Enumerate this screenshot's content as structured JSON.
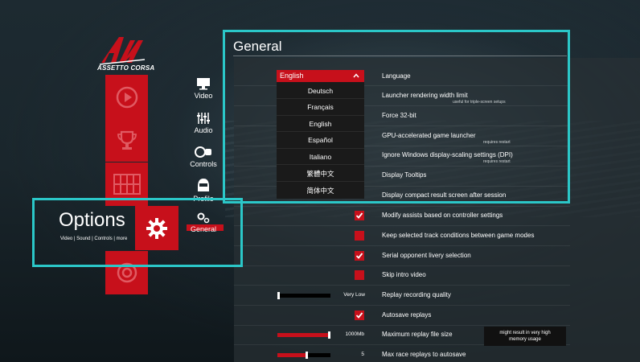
{
  "logo": {
    "text": "ASSETTO CORSA"
  },
  "main_nav": {
    "title": "Options",
    "subtitle": "Video | Sound | Controls | more"
  },
  "sub_nav": [
    {
      "label": "Video",
      "icon": "monitor-icon"
    },
    {
      "label": "Audio",
      "icon": "equalizer-icon"
    },
    {
      "label": "Controls",
      "icon": "controls-icon"
    },
    {
      "label": "Profile",
      "icon": "helmet-icon"
    },
    {
      "label": "General",
      "icon": "gears-icon"
    }
  ],
  "panel": {
    "title": "General"
  },
  "dropdown": {
    "selected": "English",
    "options": [
      "Deutsch",
      "Français",
      "English",
      "Español",
      "Italiano",
      "繁體中文",
      "简体中文"
    ]
  },
  "settings": [
    {
      "label": "Language"
    },
    {
      "label": "Launcher rendering width limit",
      "note": "useful for triple-screen setups"
    },
    {
      "label": "Force 32-bit"
    },
    {
      "label": "GPU-accelerated game launcher",
      "note": "requires restart"
    },
    {
      "label": "Ignore Windows display-scaling settings (DPI)",
      "note": "requires restart"
    },
    {
      "label": "Display Tooltips"
    },
    {
      "label": "Display compact result screen after session"
    },
    {
      "label": "Modify assists based on controller settings",
      "checked": true
    },
    {
      "label": "Keep selected track conditions between game modes",
      "checked": false
    },
    {
      "label": "Serial opponent livery selection",
      "checked": true
    },
    {
      "label": "Skip intro video",
      "checked": false
    },
    {
      "label": "Replay recording quality",
      "value": "Very Low",
      "level": 0.0
    },
    {
      "label": "Autosave replays",
      "checked": true
    },
    {
      "label": "Maximum replay file size",
      "value": "1000Mb",
      "level": 1.0
    },
    {
      "label": "Max race replays to autosave",
      "value": "5",
      "level": 0.55
    }
  ],
  "tooltip": {
    "line1": "might result in very high",
    "line2": "memory usage"
  },
  "colors": {
    "accent": "#c7101b",
    "highlight": "#2bc7c8",
    "panel": "#283034"
  }
}
